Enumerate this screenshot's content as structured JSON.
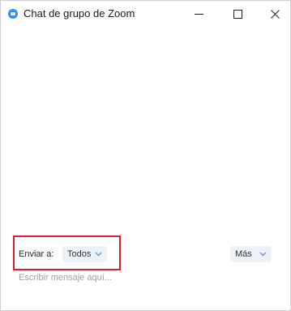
{
  "window": {
    "title": "Chat de grupo de Zoom"
  },
  "send": {
    "label": "Enviar a:",
    "recipient": "Todos"
  },
  "more_label": "Más",
  "message": {
    "placeholder": "Escribir mensaje aquí..."
  },
  "colors": {
    "accent": "#2d8cff",
    "highlight": "#d4222a",
    "dropdown_bg": "#eef1f6",
    "chevron": "#5b9bd5"
  },
  "icons": [
    "zoom-logo-icon",
    "minimize-icon",
    "maximize-icon",
    "close-icon",
    "chevron-down-icon"
  ]
}
